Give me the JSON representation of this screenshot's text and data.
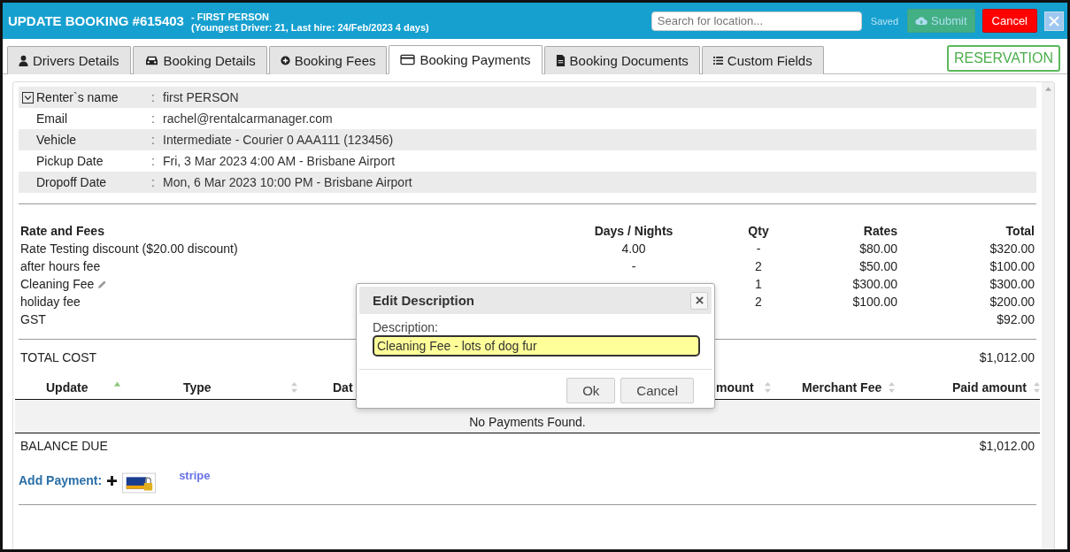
{
  "header": {
    "title": "UPDATE BOOKING #615403",
    "name": "- FIRST PERSON",
    "details": "(Youngest Driver: 21, Last hire: 24/Feb/2023 4 days)",
    "search": {
      "placeholder": "Search for location..."
    },
    "status": "Saved",
    "submit": {
      "label": "Submit",
      "disabled": true
    },
    "cancel": "Cancel"
  },
  "tabs": [
    {
      "label": "Drivers Details",
      "selected": false
    },
    {
      "label": "Booking Details",
      "selected": false
    },
    {
      "label": "Booking Fees",
      "selected": false
    },
    {
      "label": "Booking Payments",
      "selected": true
    },
    {
      "label": "Booking Documents",
      "selected": false
    },
    {
      "label": "Custom Fields",
      "selected": false
    }
  ],
  "badge": "RESERVATION",
  "renter": {
    "expanded": true,
    "rows": [
      {
        "label": "Renter`s name",
        "sep": ":",
        "value": "first PERSON"
      },
      {
        "label": "Email",
        "sep": ":",
        "value": "rachel@rentalcarmanager.com"
      },
      {
        "label": "Vehicle",
        "sep": ":",
        "value": "Intermediate - Courier 0 AAA111 (123456)"
      },
      {
        "label": "Pickup Date",
        "sep": ":",
        "value": "Fri, 3 Mar 2023 4:00 AM - Brisbane Airport"
      },
      {
        "label": "Dropoff Date",
        "sep": ":",
        "value": "Mon, 6 Mar 2023 10:00 PM - Brisbane Airport"
      }
    ]
  },
  "fees": {
    "columns": [
      "Rate and Fees",
      "Days / Nights",
      "Qty",
      "Rates",
      "Total"
    ],
    "rows": [
      {
        "cells": [
          "Rate Testing discount ($20.00 discount)",
          "4.00",
          "-",
          "$80.00",
          "$320.00"
        ],
        "editable": false
      },
      {
        "cells": [
          "after hours fee",
          "-",
          "2",
          "$50.00",
          "$100.00"
        ],
        "editable": false
      },
      {
        "cells": [
          "Cleaning Fee",
          "",
          "1",
          "$300.00",
          "$300.00"
        ],
        "editable": true
      },
      {
        "cells": [
          "holiday fee",
          "",
          "2",
          "$100.00",
          "$200.00"
        ],
        "editable": false
      },
      {
        "cells": [
          "GST",
          "",
          "",
          "",
          "$92.00"
        ],
        "editable": false
      }
    ],
    "total_label": "TOTAL COST",
    "total": "$1,012.00"
  },
  "payments": {
    "columns": [
      {
        "label": "Update",
        "sorted": true
      },
      {
        "label": "Type",
        "sorted": false
      },
      {
        "label": "Dat"
      },
      {
        "label": "mount",
        "sorted": false
      },
      {
        "label": "Merchant Fee",
        "sorted": false
      },
      {
        "label": "Paid amount",
        "sorted": false
      }
    ],
    "empty": "No Payments Found.",
    "balance_label": "BALANCE DUE",
    "balance": "$1,012.00",
    "add_payment": "Add Payment:",
    "stripe": "stripe"
  },
  "dialog": {
    "title": "Edit Description",
    "label": "Description:",
    "value": "Cleaning Fee - lots of dog fur",
    "ok": "Ok",
    "cancel": "Cancel"
  }
}
